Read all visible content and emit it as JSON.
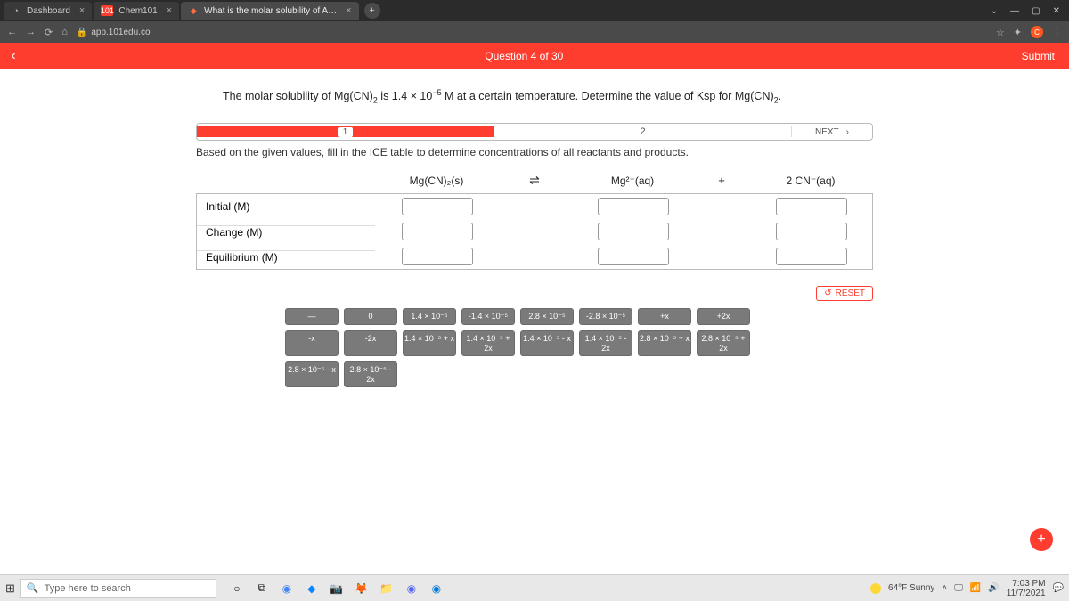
{
  "browser": {
    "tabs": [
      {
        "title": "Dashboard",
        "active": false
      },
      {
        "title": "Chem101",
        "active": false
      },
      {
        "title": "What is the molar solubility of A…",
        "active": true
      }
    ],
    "url": "app.101edu.co"
  },
  "header": {
    "indicator": "Question 4 of 30",
    "submit": "Submit"
  },
  "question": {
    "prefix": "The molar solubility of Mg(CN)",
    "sub1": "2",
    "mid": " is 1.4 × 10",
    "sup": "−5",
    "suffix": " M at a certain temperature. Determine the value of Ksp for Mg(CN)",
    "sub2": "2",
    "end": "."
  },
  "steps": {
    "s1": "1",
    "s2": "2",
    "next": "NEXT"
  },
  "instruction": "Based on the given values, fill in the ICE table to determine concentrations of all reactants and products.",
  "species": {
    "a": "Mg(CN)₂(s)",
    "eq": "⇌",
    "b": "Mg²⁺(aq)",
    "plus": "+",
    "c": "2 CN⁻(aq)"
  },
  "rows": {
    "initial": "Initial (M)",
    "change": "Change (M)",
    "equil": "Equilibrium (M)"
  },
  "reset": "RESET",
  "tiles": [
    "—",
    "0",
    "1.4 × 10⁻⁵",
    "-1.4 × 10⁻⁵",
    "2.8 × 10⁻⁵",
    "-2.8 × 10⁻⁵",
    "+x",
    "+2x",
    "-x",
    "-2x",
    "1.4 × 10⁻⁵ + x",
    "1.4 × 10⁻⁵ + 2x",
    "1.4 × 10⁻⁵ - x",
    "1.4 × 10⁻⁵ - 2x",
    "2.8 × 10⁻⁵ + x",
    "2.8 × 10⁻⁵ + 2x",
    "2.8 × 10⁻⁵ - x",
    "2.8 × 10⁻⁵ - 2x"
  ],
  "taskbar": {
    "search_placeholder": "Type here to search",
    "weather": "64°F Sunny",
    "time": "7:03 PM",
    "date": "11/7/2021"
  }
}
